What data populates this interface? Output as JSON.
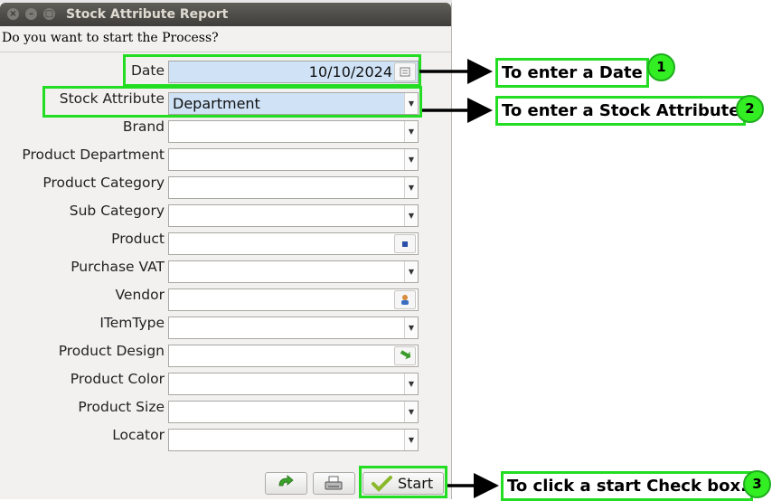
{
  "window": {
    "title": "Stock Attribute Report",
    "question": "Do you want to start the Process?"
  },
  "fields": [
    {
      "label": "Date",
      "value": "10/10/2024",
      "control": "date"
    },
    {
      "label": "Stock Attribute",
      "value": "Department",
      "control": "combo"
    },
    {
      "label": "Brand",
      "value": "",
      "control": "combo"
    },
    {
      "label": "Product Department",
      "value": "",
      "control": "combo"
    },
    {
      "label": "Product Category",
      "value": "",
      "control": "combo"
    },
    {
      "label": "Sub Category",
      "value": "",
      "control": "combo"
    },
    {
      "label": "Product",
      "value": "",
      "control": "search",
      "icon": "product-lookup-icon"
    },
    {
      "label": "Purchase VAT",
      "value": "",
      "control": "combo"
    },
    {
      "label": "Vendor",
      "value": "",
      "control": "search",
      "icon": "vendor-lookup-icon"
    },
    {
      "label": "ITemType",
      "value": "",
      "control": "combo"
    },
    {
      "label": "Product Design",
      "value": "",
      "control": "search",
      "icon": "design-lookup-icon"
    },
    {
      "label": "Product Color",
      "value": "",
      "control": "combo"
    },
    {
      "label": "Product Size",
      "value": "",
      "control": "combo"
    },
    {
      "label": "Locator",
      "value": "",
      "control": "combo"
    }
  ],
  "buttons": {
    "start_label": "Start",
    "refresh_icon": "refresh-arrow-icon",
    "print_icon": "printer-icon"
  },
  "annotations": [
    {
      "number": "1",
      "text": "To enter a Date"
    },
    {
      "number": "2",
      "text": "To enter a Stock Attribute"
    },
    {
      "number": "3",
      "text": "To click a start Check box."
    }
  ],
  "colors": {
    "highlight": "#22dd22",
    "badge": "#33ee22",
    "selected_field": "#cfe2f6",
    "titlebar": "#4a4945"
  }
}
